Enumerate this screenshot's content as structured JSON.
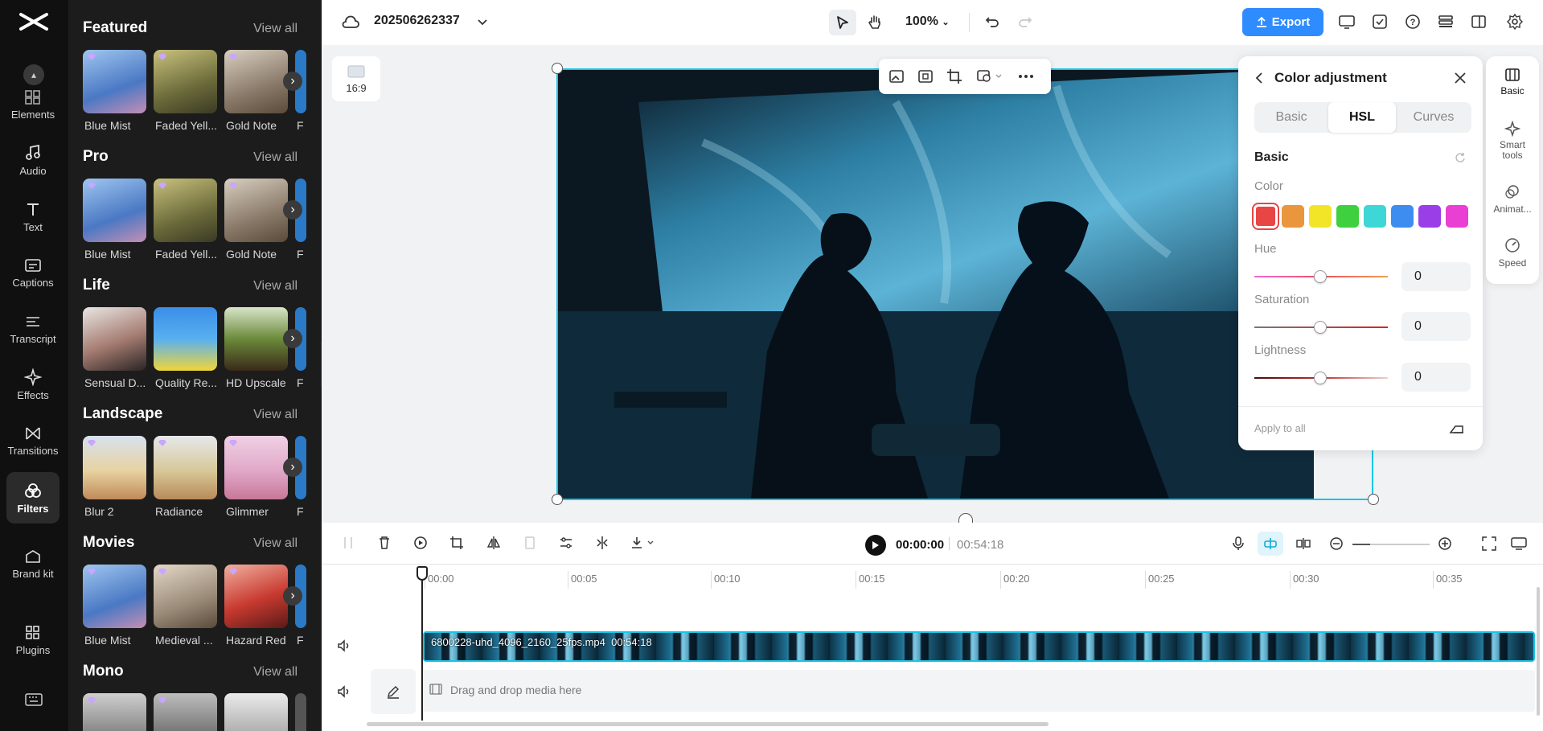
{
  "app": {
    "project_name": "202506262337"
  },
  "left_rail": {
    "items": [
      {
        "label": "Elements",
        "icon": "elements-icon"
      },
      {
        "label": "Audio",
        "icon": "audio-icon"
      },
      {
        "label": "Text",
        "icon": "text-icon"
      },
      {
        "label": "Captions",
        "icon": "captions-icon"
      },
      {
        "label": "Transcript",
        "icon": "transcript-icon"
      },
      {
        "label": "Effects",
        "icon": "effects-icon"
      },
      {
        "label": "Transitions",
        "icon": "transitions-icon"
      },
      {
        "label": "Filters",
        "icon": "filters-icon",
        "active": true
      },
      {
        "label": "Brand kit",
        "icon": "brand-kit-icon"
      },
      {
        "label": "Plugins",
        "icon": "plugins-icon"
      }
    ]
  },
  "filters": {
    "view_all": "View all",
    "sections": [
      {
        "title": "Featured",
        "items": [
          "Blue Mist",
          "Faded Yell...",
          "Gold Note",
          "F"
        ]
      },
      {
        "title": "Pro",
        "items": [
          "Blue Mist",
          "Faded Yell...",
          "Gold Note",
          "F"
        ]
      },
      {
        "title": "Life",
        "items": [
          "Sensual D...",
          "Quality Re...",
          "HD Upscale",
          "F"
        ]
      },
      {
        "title": "Landscape",
        "items": [
          "Blur 2",
          "Radiance",
          "Glimmer",
          "F"
        ]
      },
      {
        "title": "Movies",
        "items": [
          "Blue Mist",
          "Medieval ...",
          "Hazard Red",
          "F"
        ]
      },
      {
        "title": "Mono",
        "items": [
          "",
          "",
          "",
          ""
        ]
      }
    ]
  },
  "topbar": {
    "zoom": "100%",
    "export_label": "Export"
  },
  "canvas": {
    "ratio_label": "16:9"
  },
  "color_panel": {
    "title": "Color adjustment",
    "tabs": [
      "Basic",
      "HSL",
      "Curves"
    ],
    "active_tab": "HSL",
    "section_title": "Basic",
    "color_label": "Color",
    "swatches": [
      "#e84545",
      "#ea963c",
      "#f2e528",
      "#3fd040",
      "#3ed6d6",
      "#3d8df0",
      "#9a3fe8",
      "#ea3fd3"
    ],
    "hue": {
      "label": "Hue",
      "value": "0"
    },
    "saturation": {
      "label": "Saturation",
      "value": "0"
    },
    "lightness": {
      "label": "Lightness",
      "value": "0"
    },
    "apply_all": "Apply to all"
  },
  "right_tabs": [
    {
      "label": "Basic"
    },
    {
      "label": "Smart tools"
    },
    {
      "label": "Animat..."
    },
    {
      "label": "Speed"
    }
  ],
  "playback": {
    "current": "00:00:00",
    "total": "00:54:18"
  },
  "timeline": {
    "ticks": [
      "00:00",
      "00:05",
      "00:10",
      "00:15",
      "00:20",
      "00:25",
      "00:30",
      "00:35"
    ],
    "clip_name": "6800228-uhd_4096_2160_25fps.mp4",
    "clip_duration": "00:54:18",
    "drop_text": "Drag and drop media here"
  }
}
